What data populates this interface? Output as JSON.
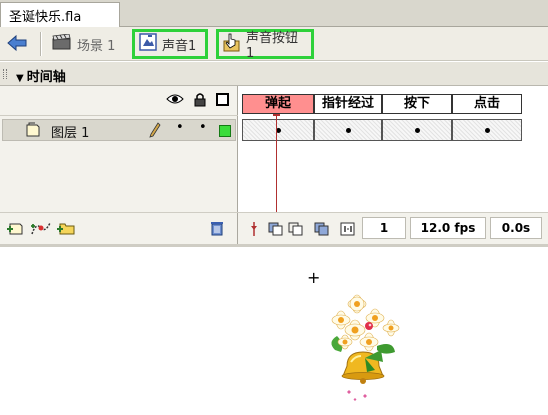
{
  "document": {
    "tab_title": "圣诞快乐.fla"
  },
  "breadcrumb": {
    "scene_label": "场景 1",
    "symbol1_label": "声音1",
    "symbol2_label": "声音按钮1",
    "highlight_color": "#2ed13a"
  },
  "timeline": {
    "title": "时间轴",
    "frame_labels": [
      "弹起",
      "指针经过",
      "按下",
      "点击"
    ],
    "active_frame_color": "#ff8f8f",
    "layers": [
      {
        "name": "图层 1",
        "visible_marker": "•",
        "lock_marker": "•",
        "outline_color": "#3bdc3b"
      }
    ],
    "status": {
      "current_frame": "1",
      "fps": "12.0 fps",
      "time": "0.0s"
    }
  },
  "icons": {
    "back": "back-arrow-icon",
    "scene": "clapperboard-icon",
    "graphic": "graphic-symbol-icon",
    "button": "button-symbol-icon",
    "eye": "eye-icon",
    "lock": "lock-icon",
    "outline": "outline-square-icon",
    "trash": "trash-icon"
  }
}
